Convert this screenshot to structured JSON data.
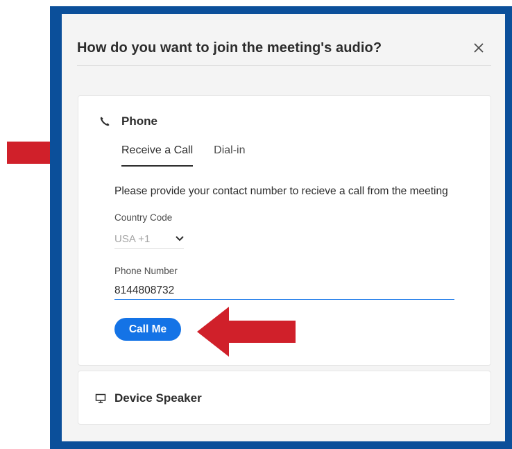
{
  "dialog": {
    "title": "How do you want to join the meeting's audio?",
    "close_icon": "close-icon"
  },
  "phone": {
    "label": "Phone",
    "icon": "phone-icon",
    "tabs": [
      {
        "label": "Receive a Call",
        "active": true
      },
      {
        "label": "Dial-in",
        "active": false
      }
    ],
    "description": "Please provide your contact number to recieve a call from the meeting",
    "country_code": {
      "label": "Country Code",
      "value": "USA +1"
    },
    "phone_number": {
      "label": "Phone Number",
      "value": "8144808732"
    },
    "call_button": "Call Me"
  },
  "speaker": {
    "label": "Device Speaker",
    "icon": "monitor-icon"
  },
  "annotations": {
    "color": "#d0202a"
  }
}
